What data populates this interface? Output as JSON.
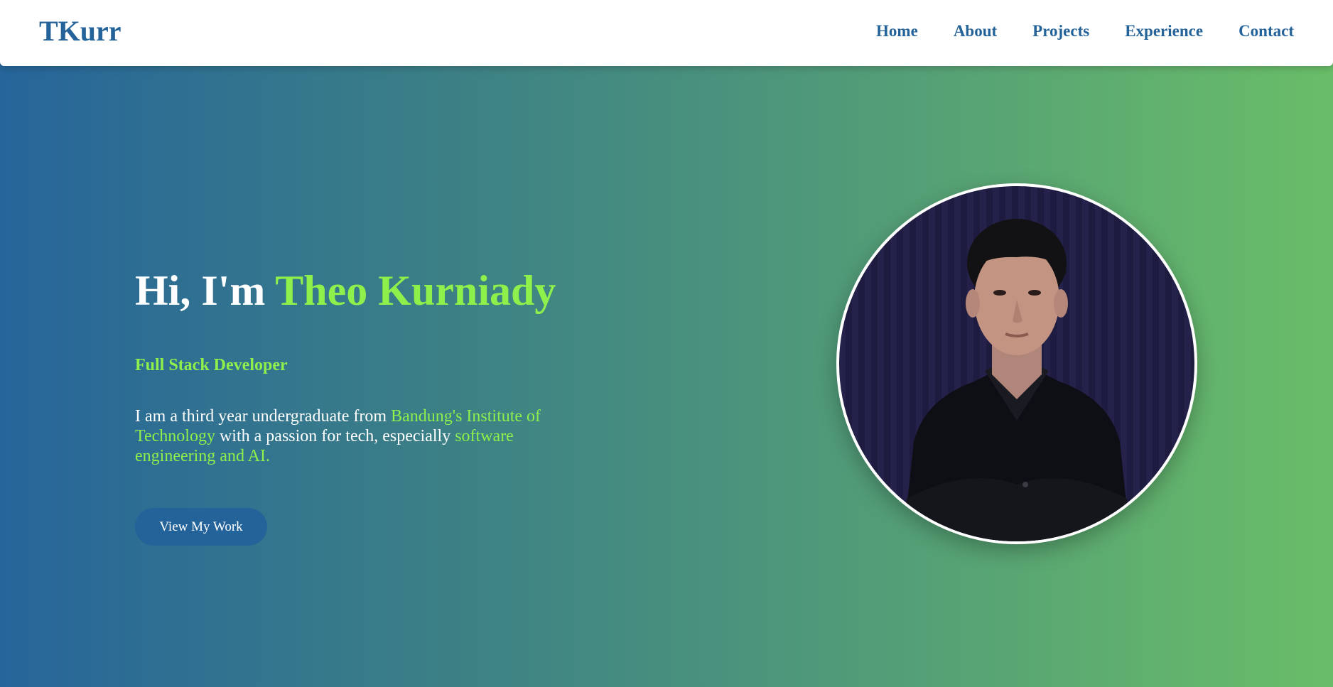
{
  "nav": {
    "logo": "TKurr",
    "links": [
      "Home",
      "About",
      "Projects",
      "Experience",
      "Contact"
    ]
  },
  "hero": {
    "greeting": "Hi, I'm ",
    "name": "Theo Kurniady",
    "role": "Full Stack Developer",
    "desc_1": "I am a third year undergraduate from ",
    "desc_highlight_1": "Bandung's Institute of Technology",
    "desc_2": " with a passion for tech, especially ",
    "desc_highlight_2": "software engineering and AI.",
    "cta_label": "View My Work"
  },
  "colors": {
    "primary": "#24639a",
    "accent": "#8ef04a",
    "gradient_start": "#26659a",
    "gradient_end": "#6abd68",
    "white": "#ffffff"
  },
  "avatar": {
    "icon": "profile-photo"
  }
}
